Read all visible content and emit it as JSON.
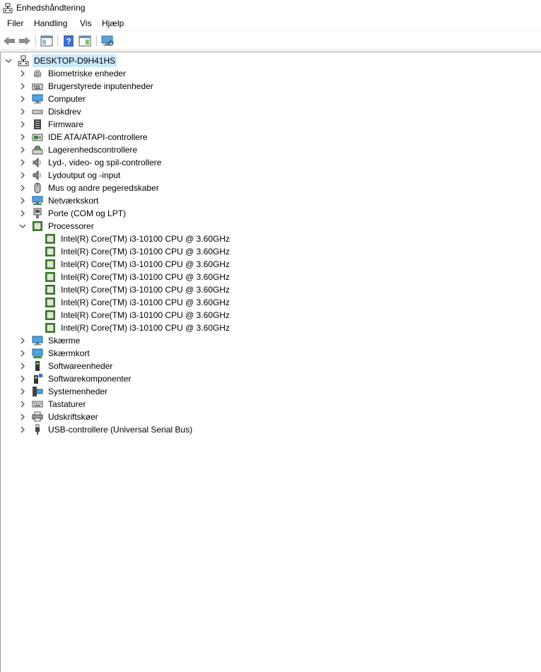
{
  "window": {
    "title": "Enhedshåndtering"
  },
  "menu": {
    "items": [
      "Filer",
      "Handling",
      "Vis",
      "Hjælp"
    ]
  },
  "toolbar": {
    "buttons": [
      "back-arrow-icon",
      "forward-arrow-icon",
      "show-hide-console-tree-icon",
      "help-icon",
      "properties-pane-icon",
      "scan-hardware-icon"
    ]
  },
  "tree": {
    "root": {
      "label": "DESKTOP-D9H41HS",
      "expanded": true,
      "icon": "computer-root-icon"
    },
    "categories": [
      {
        "label": "Biometriske enheder",
        "icon": "fingerprint-icon",
        "expanded": false
      },
      {
        "label": "Brugerstyrede inputenheder",
        "icon": "hid-keyboard-icon",
        "expanded": false
      },
      {
        "label": "Computer",
        "icon": "monitor-icon",
        "expanded": false
      },
      {
        "label": "Diskdrev",
        "icon": "disk-drive-icon",
        "expanded": false
      },
      {
        "label": "Firmware",
        "icon": "chip-board-icon",
        "expanded": false
      },
      {
        "label": "IDE ATA/ATAPI-controllere",
        "icon": "ide-controller-icon",
        "expanded": false
      },
      {
        "label": "Lagerenhedscontrollere",
        "icon": "storage-controller-icon",
        "expanded": false
      },
      {
        "label": "Lyd-, video- og spil-controllere",
        "icon": "speaker-icon",
        "expanded": false
      },
      {
        "label": "Lydoutput og -input",
        "icon": "speaker-icon",
        "expanded": false
      },
      {
        "label": "Mus og andre pegeredskaber",
        "icon": "mouse-icon",
        "expanded": false
      },
      {
        "label": "Netværkskort",
        "icon": "network-adapter-icon",
        "expanded": false
      },
      {
        "label": "Porte (COM og LPT)",
        "icon": "port-connector-icon",
        "expanded": false
      },
      {
        "label": "Processorer",
        "icon": "processor-chip-icon",
        "expanded": true,
        "children": [
          "Intel(R) Core(TM) i3-10100 CPU @ 3.60GHz",
          "Intel(R) Core(TM) i3-10100 CPU @ 3.60GHz",
          "Intel(R) Core(TM) i3-10100 CPU @ 3.60GHz",
          "Intel(R) Core(TM) i3-10100 CPU @ 3.60GHz",
          "Intel(R) Core(TM) i3-10100 CPU @ 3.60GHz",
          "Intel(R) Core(TM) i3-10100 CPU @ 3.60GHz",
          "Intel(R) Core(TM) i3-10100 CPU @ 3.60GHz",
          "Intel(R) Core(TM) i3-10100 CPU @ 3.60GHz"
        ]
      },
      {
        "label": "Skærme",
        "icon": "monitor-icon",
        "expanded": false
      },
      {
        "label": "Skærmkort",
        "icon": "display-adapter-icon",
        "expanded": false
      },
      {
        "label": "Softwareenheder",
        "icon": "software-device-icon",
        "expanded": false
      },
      {
        "label": "Softwarekomponenter",
        "icon": "software-component-icon",
        "expanded": false
      },
      {
        "label": "Systemenheder",
        "icon": "system-device-icon",
        "expanded": false
      },
      {
        "label": "Tastaturer",
        "icon": "keyboard-icon",
        "expanded": false
      },
      {
        "label": "Udskriftskøer",
        "icon": "printer-icon",
        "expanded": false
      },
      {
        "label": "USB-controllere (Universal Serial Bus)",
        "icon": "usb-plug-icon",
        "expanded": false
      }
    ]
  },
  "colors": {
    "selection": "#cce8ff",
    "chevron": "#4d4d4d",
    "border": "#a0a0a0"
  }
}
